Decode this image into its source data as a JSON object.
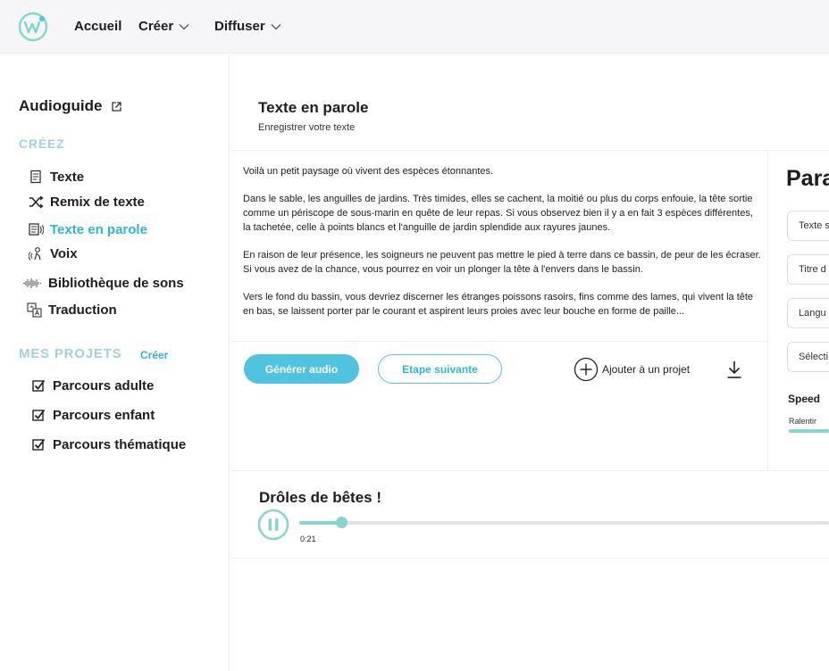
{
  "nav": {
    "logo": "logo-w",
    "items": [
      {
        "label": "Accueil",
        "has_dropdown": false
      },
      {
        "label": "Créer",
        "has_dropdown": true
      },
      {
        "label": "Diffuser",
        "has_dropdown": true
      }
    ]
  },
  "sidebar": {
    "title": "Audioguide",
    "section_create": "CRÉEZ",
    "create_items": [
      {
        "label": "Texte",
        "icon": "document-icon"
      },
      {
        "label": "Remix de texte",
        "icon": "shuffle-icon"
      },
      {
        "label": "Texte en parole",
        "icon": "text-to-speech-icon",
        "active": true
      },
      {
        "label": "Voix",
        "icon": "voice-icon"
      },
      {
        "label": "Bibliothèque de sons",
        "icon": "waveform-icon"
      },
      {
        "label": "Traduction",
        "icon": "translate-icon"
      }
    ],
    "section_projects": "MES PROJETS",
    "projects_create": "Créer",
    "projects": [
      {
        "label": "Parcours adulte",
        "checked": true
      },
      {
        "label": "Parcours enfant",
        "checked": true
      },
      {
        "label": "Parcours thématique",
        "checked": true
      }
    ]
  },
  "main": {
    "title": "Texte en parole",
    "subtitle": "Enregistrer votre texte",
    "paragraphs": [
      "Voilà un petit paysage où vivent des espèces étonnantes.",
      "Dans le sable, les anguilles de jardins. Très timides, elles se cachent, la moitié ou plus du corps enfouie, la tête sortie comme un périscope de sous-marin en quête de leur repas. Si vous observez bien il y a en fait 3 espèces différentes, la tachetée, celle à points blancs et l'anguille de jardin splendide aux rayures jaunes.",
      "En raison de leur présence, les soigneurs ne peuvent pas mettre le pied à terre dans ce bassin, de peur de les écraser. Si vous avez de la chance, vous pourrez en voir un plonger la tête à l'envers dans le bassin.",
      "Vers le fond du bassin, vous devriez discerner les étranges poissons rasoirs, fins comme des lames, qui vivent la tête en bas, se laissent porter par le courant et aspirent leurs proies avec leur bouche en forme de paille..."
    ],
    "generate_label": "Générer audio",
    "next_label": "Etape suivante",
    "add_project_label": "Ajouter à un projet"
  },
  "params": {
    "title": "Para",
    "fields": [
      "Texte s",
      "Titre d",
      "Langu",
      "Sélecti"
    ],
    "speed_label": "Speed",
    "speed_min_label": "Ralentir"
  },
  "player": {
    "title": "Drôles de bêtes !",
    "time": "0:21",
    "progress_fraction": 0.08
  },
  "colors": {
    "accent": "#2fb3d6",
    "button": "#4fc3e0",
    "teal": "#86d6cf",
    "section": "#a3cfe0"
  }
}
